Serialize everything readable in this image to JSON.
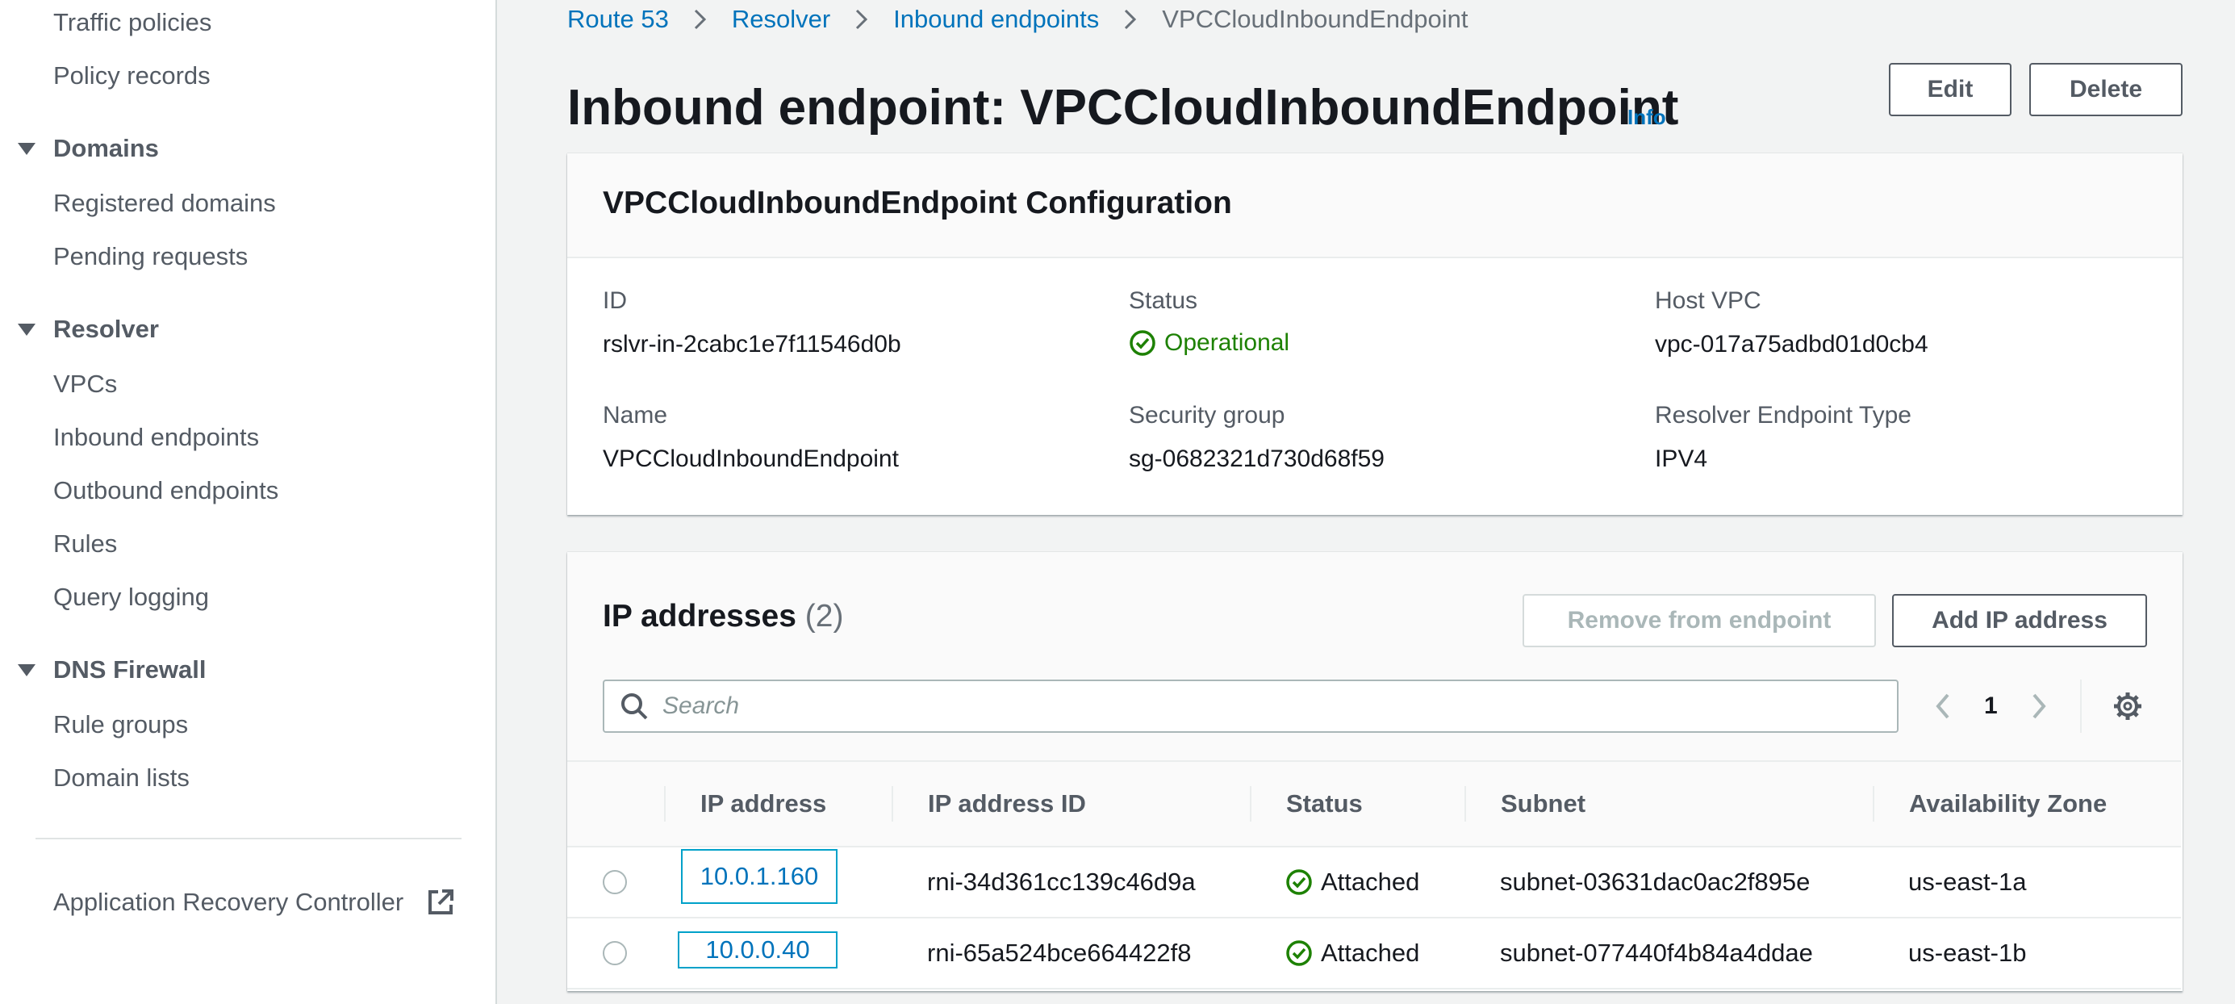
{
  "sidebar": {
    "items": {
      "traffic_policies": "Traffic policies",
      "policy_records": "Policy records",
      "domains_section": "Domains",
      "registered_domains": "Registered domains",
      "pending_requests": "Pending requests",
      "resolver_section": "Resolver",
      "vpcs": "VPCs",
      "inbound_endpoints": "Inbound endpoints",
      "outbound_endpoints": "Outbound endpoints",
      "rules": "Rules",
      "query_logging": "Query logging",
      "dns_firewall_section": "DNS Firewall",
      "rule_groups": "Rule groups",
      "domain_lists": "Domain lists",
      "app_recovery_controller": "Application Recovery Controller"
    }
  },
  "breadcrumb": {
    "route53": "Route 53",
    "resolver": "Resolver",
    "inbound_endpoints": "Inbound endpoints",
    "current": "VPCCloudInboundEndpoint"
  },
  "header": {
    "title": "Inbound endpoint: VPCCloudInboundEndpoint",
    "info": "Info",
    "edit_label": "Edit",
    "delete_label": "Delete"
  },
  "config": {
    "title": "VPCCloudInboundEndpoint Configuration",
    "fields": {
      "id_label": "ID",
      "id_value": "rslvr-in-2cabc1e7f11546d0b",
      "status_label": "Status",
      "status_value": "Operational",
      "host_vpc_label": "Host VPC",
      "host_vpc_value": "vpc-017a75adbd01d0cb4",
      "name_label": "Name",
      "name_value": "VPCCloudInboundEndpoint",
      "sg_label": "Security group",
      "sg_value": "sg-0682321d730d68f59",
      "type_label": "Resolver Endpoint Type",
      "type_value": "IPV4"
    }
  },
  "ip_addresses": {
    "title": "IP addresses",
    "count": "(2)",
    "remove_label": "Remove from endpoint",
    "add_label": "Add IP address",
    "search_placeholder": "Search",
    "page": "1",
    "columns": {
      "ip": "IP address",
      "ip_id": "IP address ID",
      "status": "Status",
      "subnet": "Subnet",
      "az": "Availability Zone"
    },
    "rows": [
      {
        "ip": "10.0.1.160",
        "ip_id": "rni-34d361cc139c46d9a",
        "status": "Attached",
        "subnet": "subnet-03631dac0ac2f895e",
        "az": "us-east-1a"
      },
      {
        "ip": "10.0.0.40",
        "ip_id": "rni-65a524bce664422f8",
        "status": "Attached",
        "subnet": "subnet-077440f4b84a4ddae",
        "az": "us-east-1b"
      }
    ]
  },
  "colors": {
    "link": "#0073bb",
    "success": "#1d8102",
    "selection_outline": "#00a1c9"
  }
}
